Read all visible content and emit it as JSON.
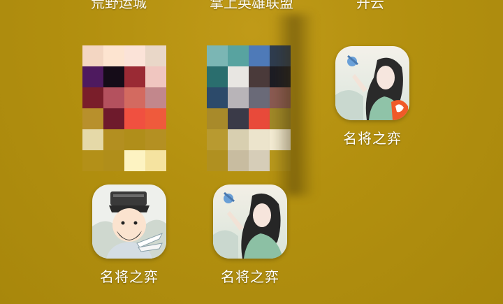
{
  "top_row_labels": [
    "荒野运城",
    "掌上英雄联盟",
    "开云"
  ],
  "apps": [
    {
      "name": "名将之弈"
    },
    {
      "name": "名将之弈"
    },
    {
      "name": "名将之弈"
    }
  ],
  "mosaic_left": [
    "#f3d6c2",
    "#fde4d0",
    "#fbe3d8",
    "#e9d7c8",
    "#4e1a5f",
    "#150c18",
    "#9a2a34",
    "#f0c6c0",
    "#7a1e2a",
    "#b4515e",
    "#d36a60",
    "#c2878c",
    "#b8902c",
    "#6e1a2c",
    "#f05040",
    "#ef5a3c",
    "#e5d9a8",
    "#b38f20",
    "#b08e1a",
    "#b49022",
    "#b39018",
    "#b08e1a",
    "#fdf3c2",
    "#f5e3a0"
  ],
  "mosaic_right": [
    "#7bb6b4",
    "#58a3a0",
    "#4e7ab8",
    "#2e3c50",
    "#2a6e6e",
    "#e8e6e2",
    "#4a3a3a",
    "#1c1c24",
    "#2c4a6a",
    "#b8b4b8",
    "#6a6a78",
    "#8a5a52",
    "#a88a2a",
    "#3a3a48",
    "#e84a3a",
    "#a08828",
    "#b89a30",
    "#d8cfb0",
    "#ece4cc",
    "#f4ecd4",
    "#b09020",
    "#c8bca0",
    "#d6cdb8",
    "#b8981c"
  ]
}
